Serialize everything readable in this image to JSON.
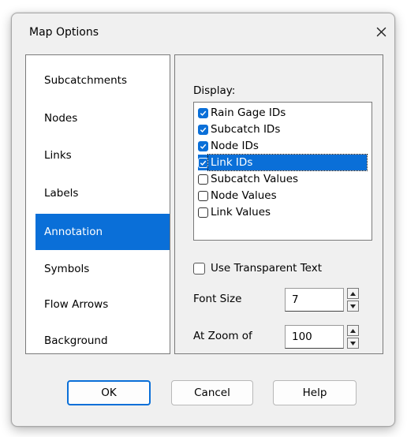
{
  "window": {
    "title": "Map Options",
    "close_icon": "close-icon"
  },
  "nav": {
    "selected": "Annotation",
    "items": [
      "Subcatchments",
      "Nodes",
      "Links",
      "Labels",
      "Annotation",
      "Symbols",
      "Flow Arrows",
      "Background"
    ]
  },
  "display": {
    "label": "Display:",
    "options": [
      {
        "label": "Rain Gage IDs",
        "checked": true
      },
      {
        "label": "Subcatch IDs",
        "checked": true
      },
      {
        "label": "Node IDs",
        "checked": true
      },
      {
        "label": "Link IDs",
        "checked": true,
        "selected": true
      },
      {
        "label": "Subcatch Values",
        "checked": false
      },
      {
        "label": "Node Values",
        "checked": false
      },
      {
        "label": "Link Values",
        "checked": false
      }
    ]
  },
  "transparent_text": {
    "label": "Use Transparent Text",
    "checked": false
  },
  "font_size": {
    "label": "Font Size",
    "value": "7"
  },
  "zoom": {
    "label": "At Zoom of",
    "value": "100"
  },
  "buttons": {
    "ok": "OK",
    "cancel": "Cancel",
    "help": "Help"
  },
  "colors": {
    "accent": "#0a6fd8",
    "dialog_bg": "#f0f0f0"
  }
}
